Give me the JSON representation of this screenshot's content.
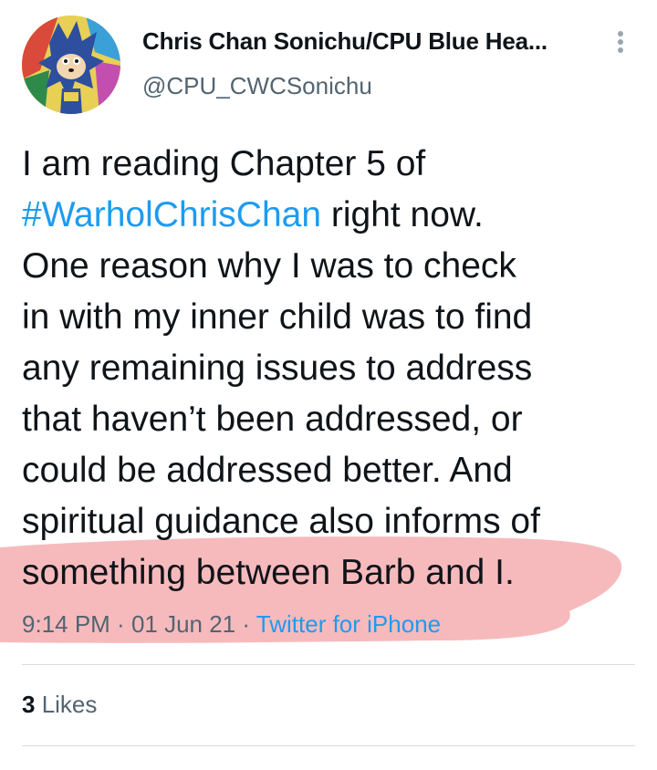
{
  "tweet": {
    "author": {
      "display_name": "Chris Chan Sonichu/CPU Blue Hea...",
      "handle": "@CPU_CWCSonichu",
      "avatar_icon": "profile-avatar"
    },
    "text": {
      "line1": "I am reading Chapter 5 of",
      "hashtag": "#WarholChrisChan",
      "line2_rest": " right now.",
      "line3": "One reason why I was to check",
      "line4": "in with my inner child was to find",
      "line5": "any remaining issues to address",
      "line6": "that haven’t been addressed, or",
      "line7": "could be addressed better. And",
      "line8": "spiritual guidance also informs of",
      "line9": "something between Barb and I."
    },
    "meta": {
      "time": "9:14 PM",
      "separator": " · ",
      "date": "01 Jun 21",
      "source": "Twitter for iPhone"
    },
    "stats": {
      "likes_count": "3",
      "likes_label": " Likes"
    },
    "more_icon": "more-vertical-icon"
  },
  "colors": {
    "link": "#1d9bf0",
    "secondary_text": "#536471",
    "highlight_marker": "#f4a9ad"
  }
}
